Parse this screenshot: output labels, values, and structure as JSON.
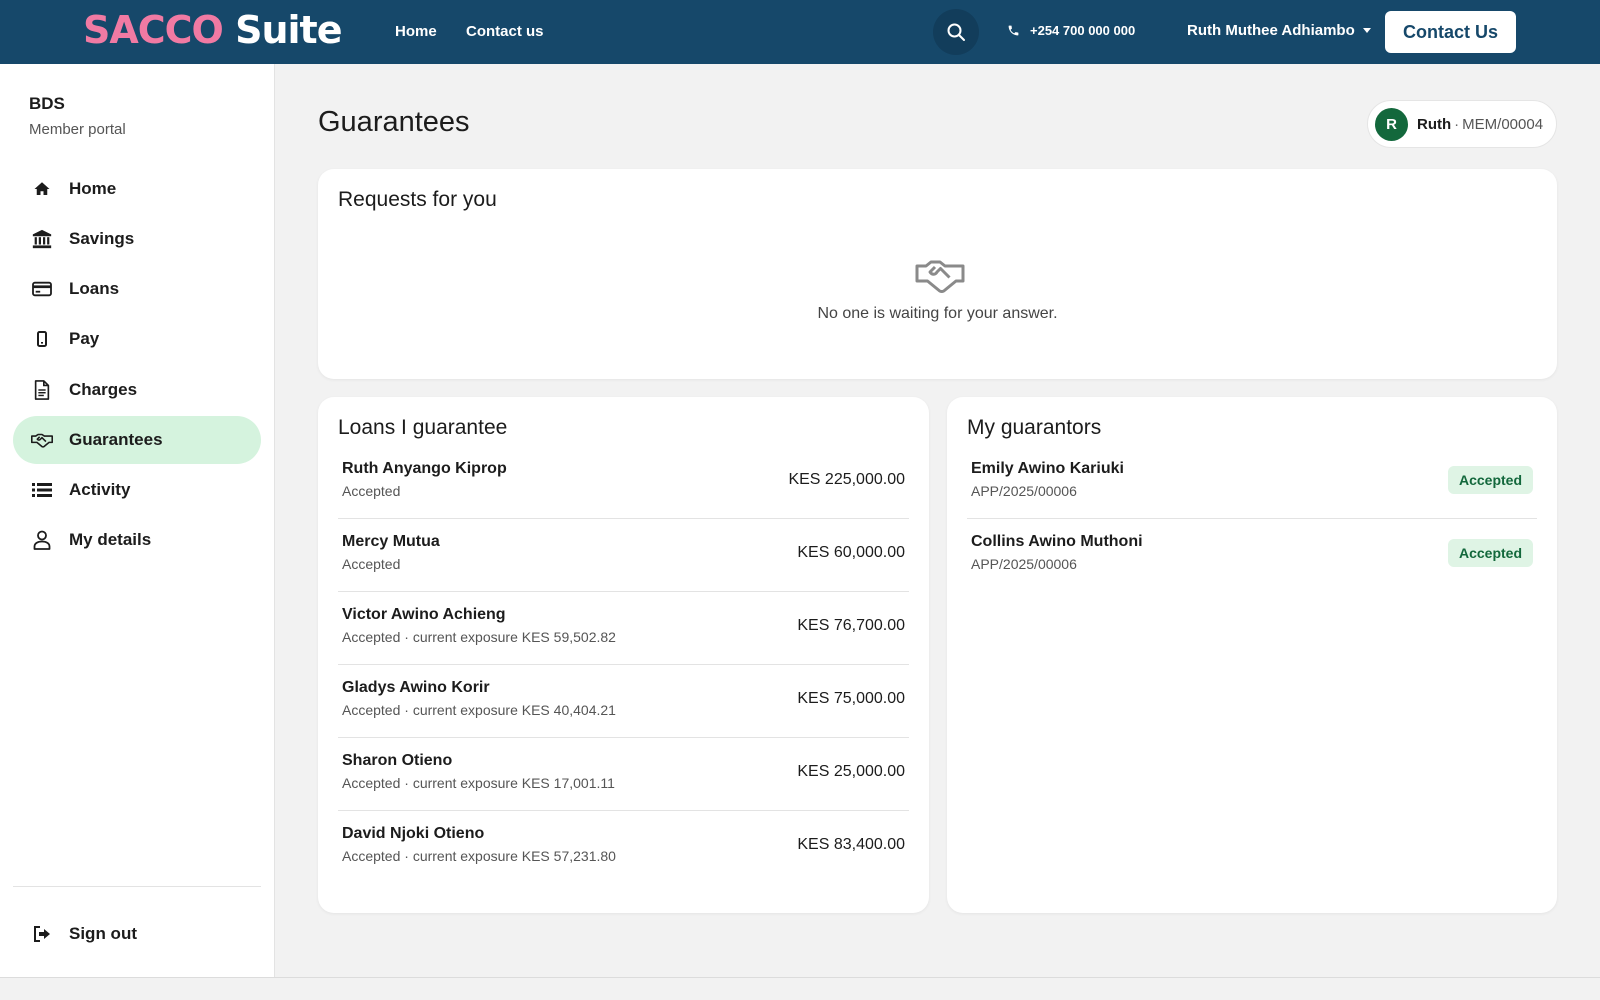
{
  "topbar": {
    "logo_part1": "SACCO",
    "logo_part2": " Suite",
    "nav": [
      {
        "label": "Home"
      },
      {
        "label": "Contact us"
      }
    ],
    "phone": "+254 700 000 000",
    "user_name": "Ruth Muthee Adhiambo",
    "contact_button": "Contact Us",
    "icons": {
      "search": "search-icon",
      "phone": "phone-icon",
      "caret": "chevron-down-icon"
    }
  },
  "sidebar": {
    "org_name": "BDS",
    "org_subtitle": "Member portal",
    "items": [
      {
        "label": "Home",
        "icon": "home-icon",
        "active": false
      },
      {
        "label": "Savings",
        "icon": "bank-icon",
        "active": false
      },
      {
        "label": "Loans",
        "icon": "credit-card-icon",
        "active": false
      },
      {
        "label": "Pay",
        "icon": "mobile-phone-icon",
        "active": false
      },
      {
        "label": "Charges",
        "icon": "document-icon",
        "active": false
      },
      {
        "label": "Guarantees",
        "icon": "handshake-icon",
        "active": true
      },
      {
        "label": "Activity",
        "icon": "list-icon",
        "active": false
      },
      {
        "label": "My details",
        "icon": "user-icon",
        "active": false
      }
    ],
    "sign_out": "Sign out"
  },
  "main": {
    "title": "Guarantees",
    "member": {
      "initial": "R",
      "name": "Ruth",
      "separator": "·",
      "member_no": "MEM/00004"
    },
    "requests": {
      "title": "Requests for you",
      "empty_text": "No one is waiting for your answer."
    },
    "loans_i_guarantee": {
      "title": "Loans I guarantee",
      "rows": [
        {
          "name": "Ruth Anyango Kiprop",
          "status": "Accepted",
          "amount": "KES 225,000.00"
        },
        {
          "name": "Mercy Mutua",
          "status": "Accepted",
          "amount": "KES 60,000.00"
        },
        {
          "name": "Victor Awino Achieng",
          "status": "Accepted · current exposure KES 59,502.82",
          "amount": "KES 76,700.00"
        },
        {
          "name": "Gladys Awino Korir",
          "status": "Accepted · current exposure KES 40,404.21",
          "amount": "KES 75,000.00"
        },
        {
          "name": "Sharon Otieno",
          "status": "Accepted · current exposure KES 17,001.11",
          "amount": "KES 25,000.00"
        },
        {
          "name": "David Njoki Otieno",
          "status": "Accepted · current exposure KES 57,231.80",
          "amount": "KES 83,400.00"
        }
      ]
    },
    "my_guarantors": {
      "title": "My guarantors",
      "rows": [
        {
          "name": "Emily Awino Kariuki",
          "ref": "APP/2025/00006",
          "status": "Accepted"
        },
        {
          "name": "Collins Awino Muthoni",
          "ref": "APP/2025/00006",
          "status": "Accepted"
        }
      ]
    }
  },
  "colors": {
    "topbar": "#16486a",
    "logo_accent": "#f07aa3",
    "active_nav": "#d5f3de",
    "avatar": "#13683c",
    "badge_bg": "#dff4e5",
    "badge_text": "#13683c"
  }
}
